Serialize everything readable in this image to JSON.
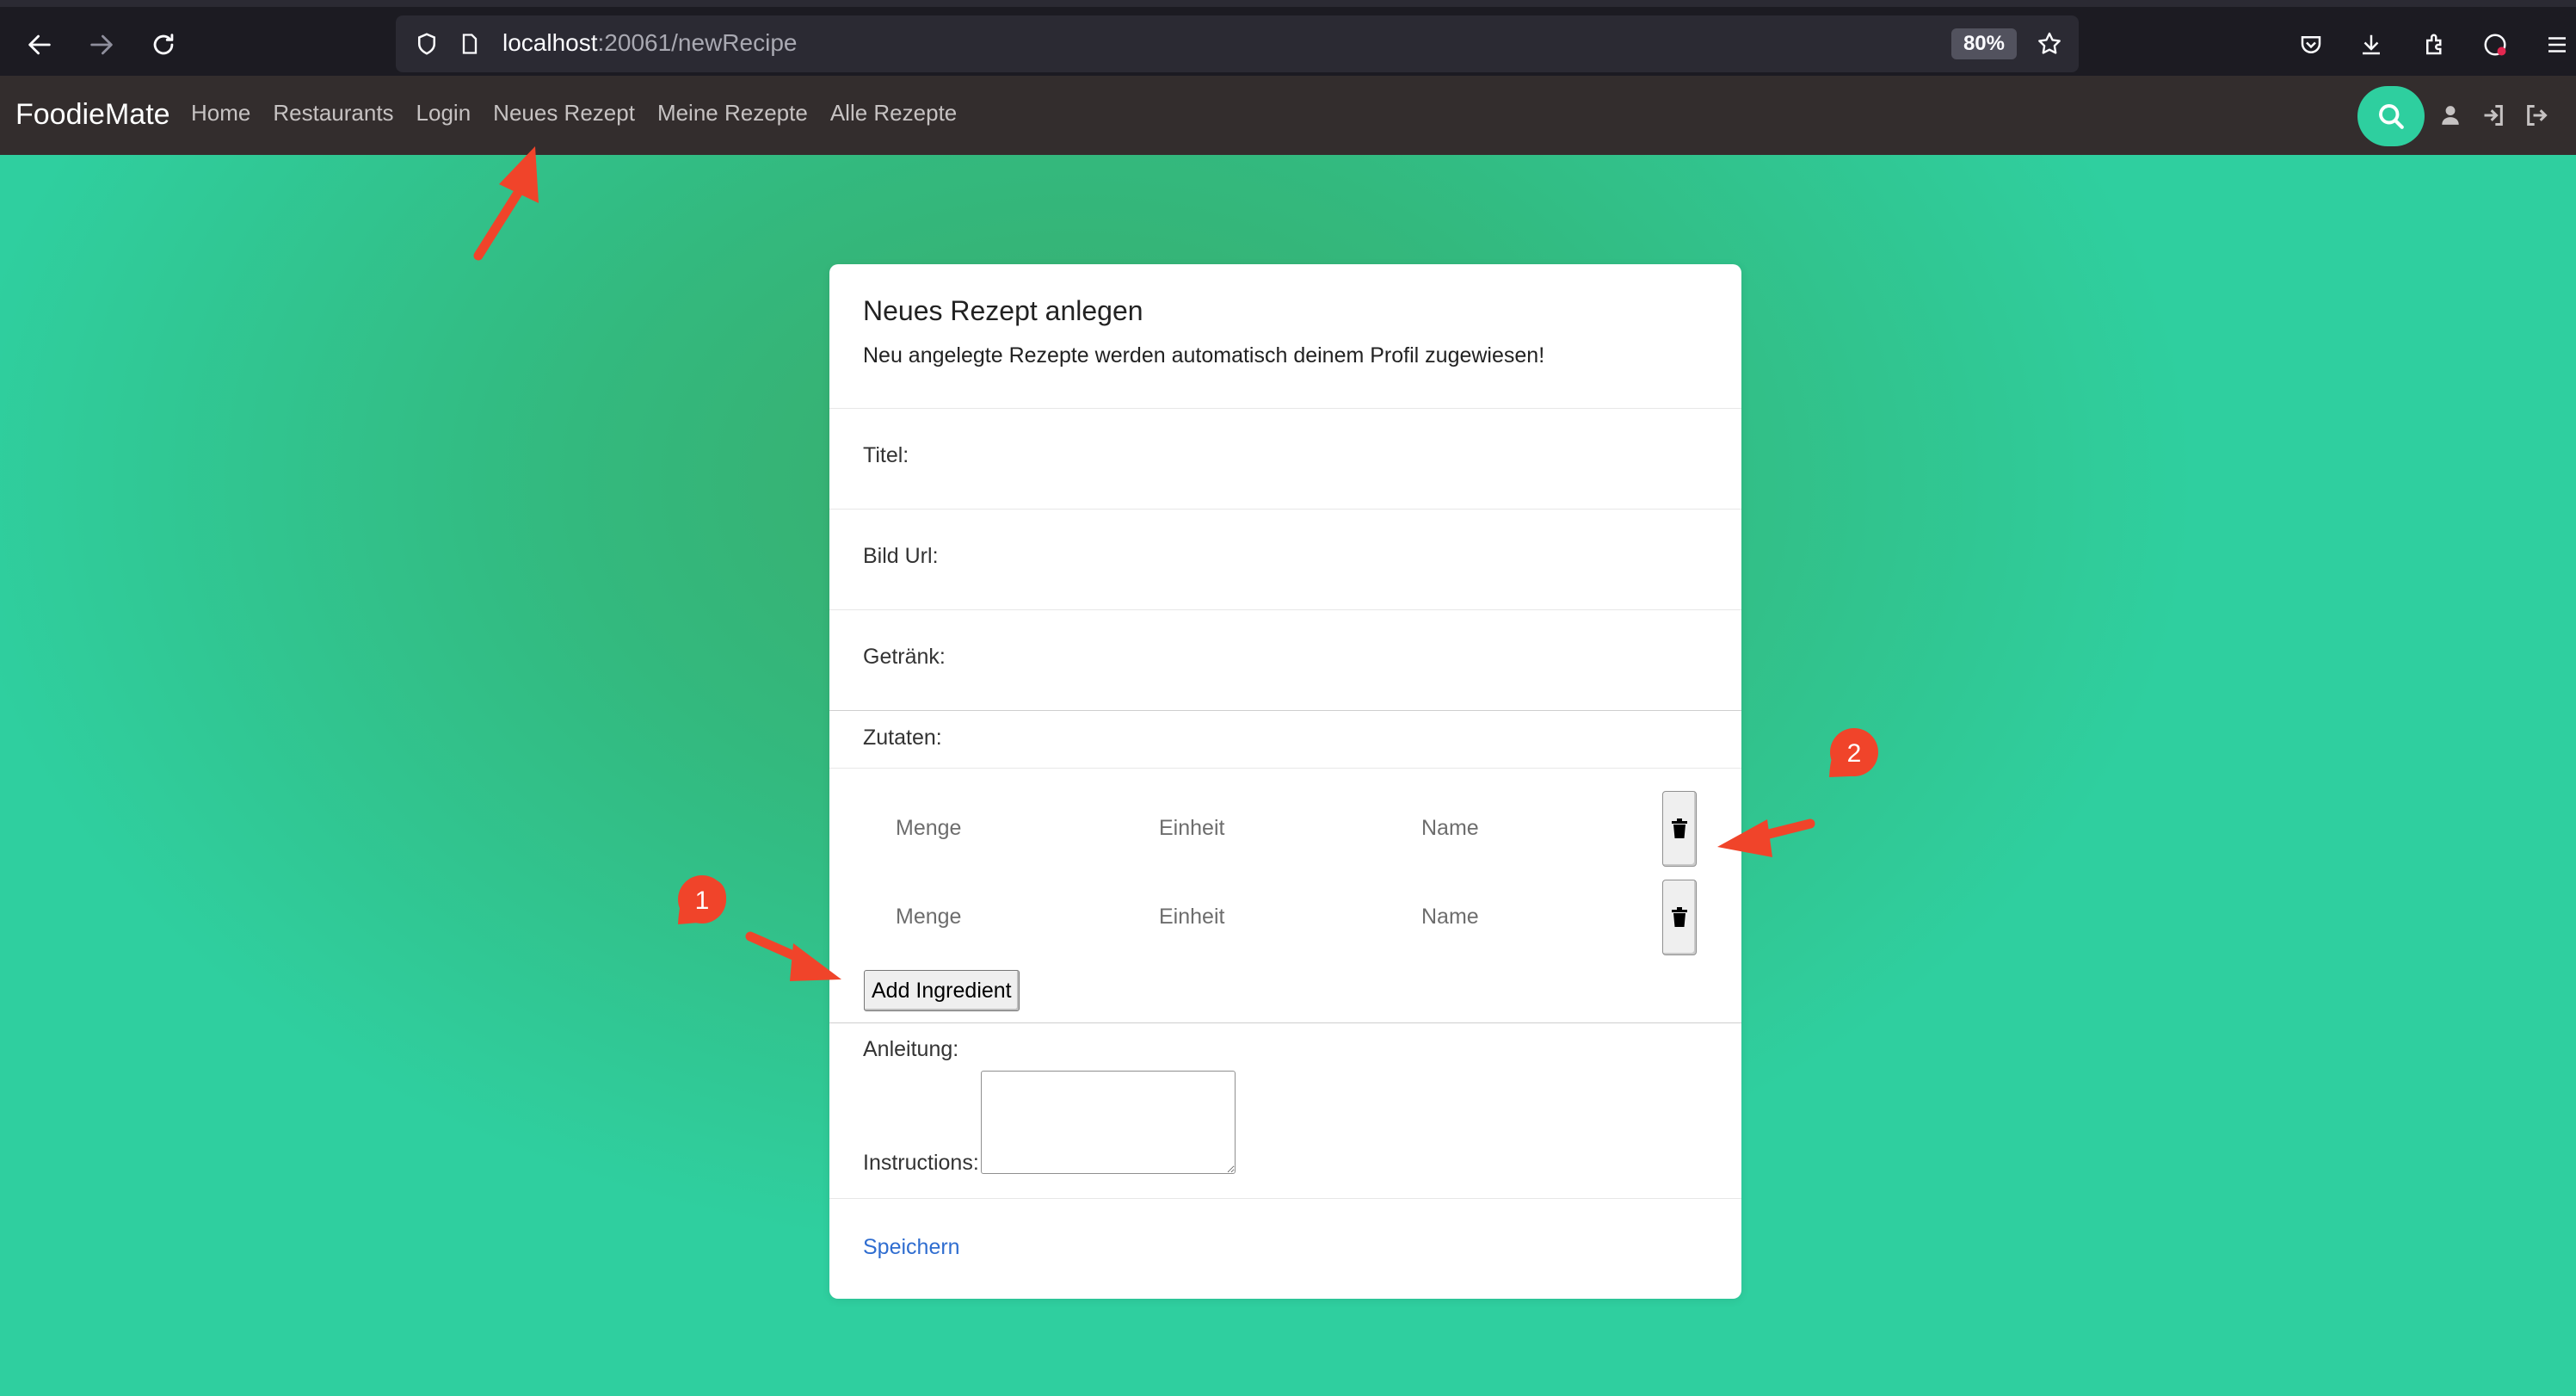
{
  "browser": {
    "url_host": "localhost",
    "url_path": ":20061/newRecipe",
    "zoom": "80%"
  },
  "navbar": {
    "brand": "FoodieMate",
    "links": [
      {
        "label": "Home"
      },
      {
        "label": "Restaurants"
      },
      {
        "label": "Login"
      },
      {
        "label": "Neues Rezept"
      },
      {
        "label": "Meine Rezepte"
      },
      {
        "label": "Alle Rezepte"
      }
    ]
  },
  "form": {
    "title": "Neues Rezept anlegen",
    "subtitle": "Neu angelegte Rezepte werden automatisch deinem Profil zugewiesen!",
    "labels": {
      "title": "Titel:",
      "image_url": "Bild Url:",
      "drink": "Getränk:",
      "ingredients": "Zutaten:",
      "instructions_section": "Anleitung:",
      "instructions": "Instructions:"
    },
    "ingredients": [
      {
        "quantity_placeholder": "Menge",
        "unit_placeholder": "Einheit",
        "name_placeholder": "Name"
      },
      {
        "quantity_placeholder": "Menge",
        "unit_placeholder": "Einheit",
        "name_placeholder": "Name"
      }
    ],
    "add_ingredient_label": "Add Ingredient",
    "save_label": "Speichern"
  },
  "annotations": {
    "marker_1": "1",
    "marker_2": "2",
    "color": "#f0442a"
  },
  "colors": {
    "navbar_bg": "#332d2d",
    "accent": "#2ecf9f",
    "link": "#2f6dd0"
  }
}
